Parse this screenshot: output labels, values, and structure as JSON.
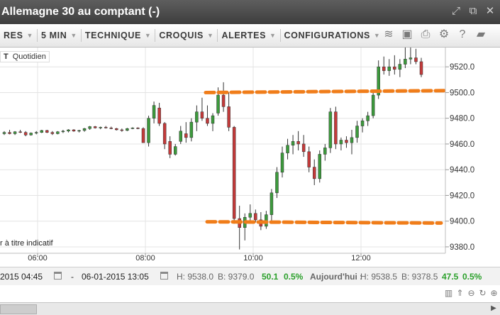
{
  "window": {
    "title": "Allemagne 30 au comptant (-)"
  },
  "toolbar": {
    "menus": [
      {
        "label": "RES"
      },
      {
        "label": "5 MIN"
      },
      {
        "label": "TECHNIQUE"
      },
      {
        "label": "CROQUIS"
      },
      {
        "label": "ALERTES"
      },
      {
        "label": "CONFIGURATIONS"
      }
    ],
    "icons": [
      "layers-icon",
      "image-icon",
      "print-icon",
      "gear-icon",
      "help-icon",
      "comment-icon"
    ]
  },
  "chart_header": {
    "prefix": "T",
    "period": "Quotidien"
  },
  "disclaimer": "r à titre indicatif",
  "status": {
    "from_date": "2015 04:45",
    "dash": "-",
    "to_date": "06-01-2015 13:05",
    "high_label": "H: 9538.0",
    "low_label": "B: 9379.0",
    "change": "50.1",
    "change_pct": "0.5%",
    "today_label": "Aujourd'hui :",
    "today_high": "H: 9538.5",
    "today_low": "B: 9378.5",
    "today_change": "47.5",
    "today_pct": "0.5%"
  },
  "colors": {
    "up": "#3c9a3c",
    "down": "#c43a3a",
    "annotation": "#f07d1a"
  },
  "chart_data": {
    "type": "candlestick",
    "x_ticks": [
      "06:00",
      "08:00",
      "10:00",
      "12:00"
    ],
    "y_ticks": [
      "9520.0",
      "9500.0",
      "9480.0",
      "9460.0",
      "9440.0",
      "9420.0",
      "9400.0",
      "9380.0"
    ],
    "ylim": [
      9375,
      9535
    ],
    "grid": true,
    "candles": [
      [
        9468.0,
        9470.0,
        9467.0,
        9469.0
      ],
      [
        9469.0,
        9471.0,
        9467.5,
        9468.0
      ],
      [
        9468.0,
        9470.0,
        9467.0,
        9469.5
      ],
      [
        9469.5,
        9471.0,
        9468.5,
        9469.0
      ],
      [
        9469.0,
        9470.0,
        9466.0,
        9467.0
      ],
      [
        9467.0,
        9469.0,
        9466.5,
        9468.5
      ],
      [
        9468.5,
        9470.0,
        9467.5,
        9469.0
      ],
      [
        9469.0,
        9471.0,
        9468.5,
        9470.5
      ],
      [
        9470.5,
        9471.0,
        9468.5,
        9469.0
      ],
      [
        9469.0,
        9470.0,
        9467.0,
        9468.0
      ],
      [
        9468.0,
        9470.0,
        9467.5,
        9469.5
      ],
      [
        9469.5,
        9471.0,
        9468.5,
        9470.0
      ],
      [
        9470.0,
        9471.5,
        9469.0,
        9471.0
      ],
      [
        9471.0,
        9471.5,
        9469.5,
        9470.0
      ],
      [
        9470.0,
        9471.0,
        9469.0,
        9470.5
      ],
      [
        9470.5,
        9472.5,
        9469.5,
        9472.0
      ],
      [
        9472.0,
        9474.0,
        9471.0,
        9473.5
      ],
      [
        9473.5,
        9474.0,
        9472.0,
        9472.5
      ],
      [
        9472.5,
        9473.5,
        9471.5,
        9473.0
      ],
      [
        9473.0,
        9474.0,
        9472.0,
        9472.5
      ],
      [
        9472.5,
        9473.5,
        9471.5,
        9472.0
      ],
      [
        9472.0,
        9472.5,
        9470.5,
        9471.0
      ],
      [
        9471.0,
        9472.0,
        9469.5,
        9470.5
      ],
      [
        9470.5,
        9472.5,
        9470.0,
        9472.0
      ],
      [
        9472.0,
        9473.0,
        9471.5,
        9472.5
      ],
      [
        9472.5,
        9473.0,
        9471.5,
        9472.0
      ],
      [
        9472.0,
        9473.0,
        9470.0,
        9461.0
      ],
      [
        9461.0,
        9482.0,
        9458.0,
        9480.0
      ],
      [
        9480.0,
        9493.0,
        9476.0,
        9490.0
      ],
      [
        9488.0,
        9492.0,
        9474.0,
        9476.0
      ],
      [
        9476.0,
        9477.0,
        9456.0,
        9460.0
      ],
      [
        9462.0,
        9466.0,
        9449.0,
        9452.0
      ],
      [
        9452.0,
        9460.0,
        9451.0,
        9458.0
      ],
      [
        9462.0,
        9474.0,
        9460.0,
        9470.0
      ],
      [
        9468.0,
        9477.0,
        9461.0,
        9465.0
      ],
      [
        9465.0,
        9480.0,
        9462.0,
        9477.0
      ],
      [
        9477.0,
        9490.0,
        9470.0,
        9485.0
      ],
      [
        9485.0,
        9496.0,
        9478.0,
        9480.0
      ],
      [
        9480.0,
        9490.0,
        9474.0,
        9476.0
      ],
      [
        9476.0,
        9484.0,
        9470.0,
        9482.0
      ],
      [
        9484.0,
        9504.0,
        9482.0,
        9498.0
      ],
      [
        9498.0,
        9508.0,
        9485.0,
        9489.0
      ],
      [
        9489.0,
        9500.0,
        9470.0,
        9473.0
      ],
      [
        9473.0,
        9474.0,
        9398.0,
        9402.0
      ],
      [
        9402.0,
        9412.0,
        9378.0,
        9395.0
      ],
      [
        9395.0,
        9406.0,
        9385.0,
        9403.0
      ],
      [
        9403.0,
        9413.0,
        9398.0,
        9406.0
      ],
      [
        9406.0,
        9409.0,
        9399.0,
        9401.0
      ],
      [
        9401.0,
        9407.0,
        9393.0,
        9396.0
      ],
      [
        9396.0,
        9408.0,
        9394.0,
        9405.0
      ],
      [
        9405.0,
        9425.0,
        9400.0,
        9422.0
      ],
      [
        9422.0,
        9442.0,
        9418.0,
        9438.0
      ],
      [
        9438.0,
        9458.0,
        9434.0,
        9453.0
      ],
      [
        9453.0,
        9464.0,
        9448.0,
        9459.0
      ],
      [
        9459.0,
        9467.0,
        9452.0,
        9462.0
      ],
      [
        9462.0,
        9470.0,
        9455.0,
        9460.0
      ],
      [
        9460.0,
        9467.0,
        9450.0,
        9454.0
      ],
      [
        9454.0,
        9458.0,
        9438.0,
        9442.0
      ],
      [
        9442.0,
        9448.0,
        9428.0,
        9433.0
      ],
      [
        9433.0,
        9455.0,
        9430.0,
        9452.0
      ],
      [
        9452.0,
        9460.0,
        9447.0,
        9457.0
      ],
      [
        9457.0,
        9488.0,
        9453.0,
        9485.0
      ],
      [
        9485.0,
        9489.0,
        9456.0,
        9460.0
      ],
      [
        9460.0,
        9465.0,
        9455.0,
        9463.0
      ],
      [
        9463.0,
        9466.0,
        9457.0,
        9461.0
      ],
      [
        9461.0,
        9471.0,
        9452.0,
        9465.0
      ],
      [
        9465.0,
        9478.0,
        9461.0,
        9474.0
      ],
      [
        9474.0,
        9480.0,
        9469.0,
        9478.0
      ],
      [
        9478.0,
        9485.0,
        9474.0,
        9482.0
      ],
      [
        9482.0,
        9500.0,
        9480.0,
        9498.0
      ],
      [
        9498.0,
        9525.0,
        9495.0,
        9520.0
      ],
      [
        9520.0,
        9528.0,
        9514.0,
        9517.0
      ],
      [
        9517.0,
        9526.0,
        9513.0,
        9520.0
      ],
      [
        9520.0,
        9529.0,
        9514.0,
        9518.0
      ],
      [
        9518.0,
        9526.0,
        9512.0,
        9522.0
      ],
      [
        9522.0,
        9535.0,
        9519.0,
        9526.0
      ],
      [
        9526.0,
        9538.0,
        9522.0,
        9527.0
      ],
      [
        9527.0,
        9534.0,
        9522.0,
        9524.0
      ],
      [
        9524.0,
        9527.0,
        9512.0,
        9514.0
      ]
    ],
    "annotations": [
      {
        "type": "hline-dashed",
        "label": "resistance",
        "y_start": 9500.0,
        "y_end": 9501.5
      },
      {
        "type": "hline-dashed",
        "label": "support",
        "y_start": 9399.5,
        "y_end": 9398.5
      }
    ]
  }
}
